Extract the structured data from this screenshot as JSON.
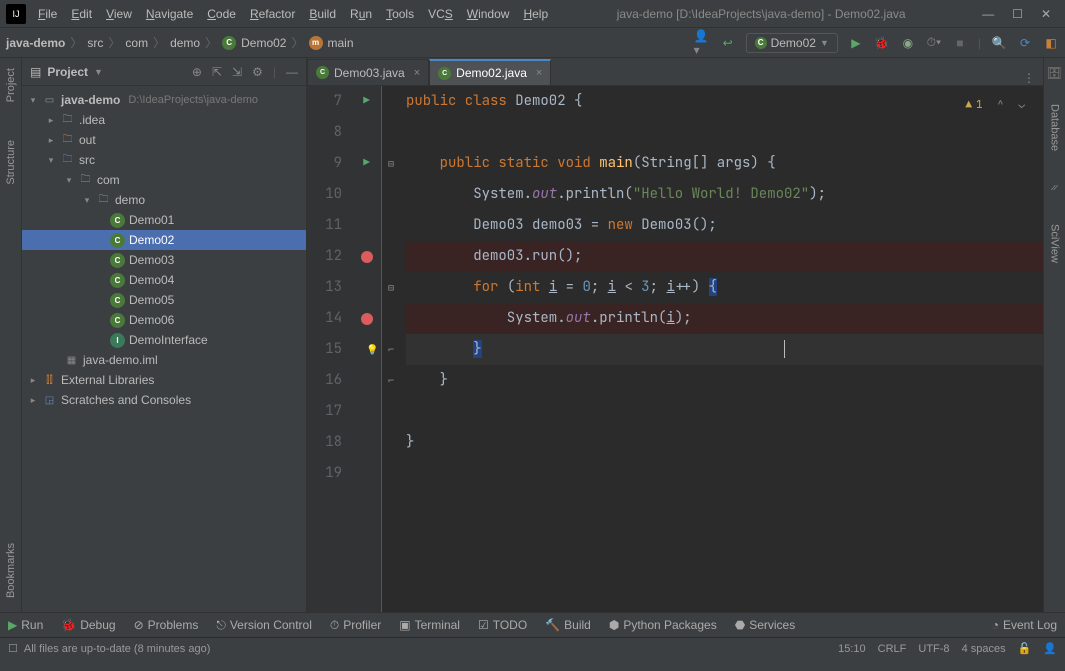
{
  "title": "java-demo [D:\\IdeaProjects\\java-demo] - Demo02.java",
  "menus": [
    "File",
    "Edit",
    "View",
    "Navigate",
    "Code",
    "Refactor",
    "Build",
    "Run",
    "Tools",
    "VCS",
    "Window",
    "Help"
  ],
  "breadcrumb": {
    "project": "java-demo",
    "src": "src",
    "pkg1": "com",
    "pkg2": "demo",
    "class": "Demo02",
    "method": "main"
  },
  "run_config": "Demo02",
  "panel_title": "Project",
  "tree": {
    "root": "java-demo",
    "root_path": "D:\\IdeaProjects\\java-demo",
    "idea": ".idea",
    "out": "out",
    "src": "src",
    "com": "com",
    "demo": "demo",
    "files": [
      "Demo01",
      "Demo02",
      "Demo03",
      "Demo04",
      "Demo05",
      "Demo06",
      "DemoInterface"
    ],
    "iml": "java-demo.iml",
    "ext": "External Libraries",
    "scratch": "Scratches and Consoles"
  },
  "tabs": [
    {
      "label": "Demo03.java",
      "active": false
    },
    {
      "label": "Demo02.java",
      "active": true
    }
  ],
  "warnings": "1",
  "code": {
    "l7": "public class Demo02 {",
    "l8": "",
    "l9a": "    public static void ",
    "l9b": "main",
    "l9c": "(String[] args) {",
    "l10a": "        System.",
    "l10b": "out",
    "l10c": ".println(",
    "l10d": "\"Hello World! Demo02\"",
    "l10e": ");",
    "l11a": "        Demo03 demo03 = ",
    "l11b": "new ",
    "l11c": "Demo03();",
    "l12": "        demo03.run();",
    "l13a": "        for ",
    "l13b": "(int ",
    "l13c": "i",
    "l13d": " = ",
    "l13e": "0",
    "l13f": "; ",
    "l13g": "i",
    "l13h": " < ",
    "l13i": "3",
    "l13j": "; ",
    "l13k": "i",
    "l13l": "++) ",
    "l13m": "{",
    "l14a": "            System.",
    "l14b": "out",
    "l14c": ".println(",
    "l14d": "i",
    "l14e": ");",
    "l15": "        }",
    "l16": "    }",
    "l17": "",
    "l18": "}",
    "l19": ""
  },
  "line_numbers": [
    "7",
    "8",
    "9",
    "10",
    "11",
    "12",
    "13",
    "14",
    "15",
    "16",
    "17",
    "18",
    "19"
  ],
  "bottom": {
    "run": "Run",
    "debug": "Debug",
    "problems": "Problems",
    "vcs": "Version Control",
    "profiler": "Profiler",
    "terminal": "Terminal",
    "todo": "TODO",
    "build": "Build",
    "python": "Python Packages",
    "services": "Services",
    "event": "Event Log"
  },
  "status": {
    "msg": "All files are up-to-date (8 minutes ago)",
    "pos": "15:10",
    "eol": "CRLF",
    "enc": "UTF-8",
    "indent": "4 spaces"
  },
  "side_tools": {
    "project": "Project",
    "structure": "Structure",
    "bookmarks": "Bookmarks",
    "database": "Database",
    "sciview": "SciView"
  }
}
